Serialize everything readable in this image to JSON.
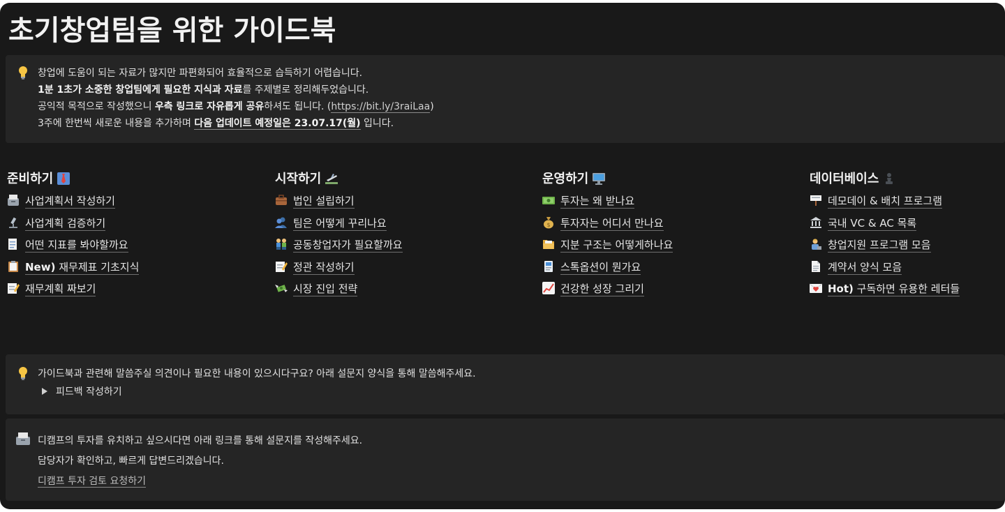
{
  "page_title": "초기창업팀을 위한 가이드북",
  "intro_callout": {
    "icon": "lightbulb-icon",
    "line1": "창업에 도움이 되는 자료가 많지만 파편화되어 효율적으로 습득하기 어렵습니다.",
    "line2_bold": "1분 1초가 소중한 창업팀에게 필요한 지식과 자료",
    "line2_rest": "를 주제별로 정리해두었습니다.",
    "line3_a": "공익적 목적으로 작성했으니 ",
    "line3_bold": "우측 링크로 자유롭게 공유",
    "line3_b": "하셔도 됩니다. (",
    "line3_link": "https://bit.ly/3raiLaa",
    "line3_c": ")",
    "line4_a": "3주에 한번씩 새로운 내용을 추가하며 ",
    "line4_bold": "다음 업데이트 예정일은 23.07.17(월)",
    "line4_b": " 입니다."
  },
  "columns": [
    {
      "heading": "준비하기",
      "heading_icon": "necktie-icon",
      "items": [
        {
          "icon": "card-file-box-icon",
          "prefix": "",
          "label": "사업계획서 작성하기"
        },
        {
          "icon": "microscope-icon",
          "prefix": "",
          "label": "사업계획 검증하기"
        },
        {
          "icon": "page-facing-up-icon",
          "prefix": "",
          "label": "어떤 지표를 봐야할까요"
        },
        {
          "icon": "clipboard-icon",
          "prefix": "New)",
          "label": " 재무제표 기초지식"
        },
        {
          "icon": "memo-icon",
          "prefix": "",
          "label": "재무계획 짜보기"
        }
      ]
    },
    {
      "heading": "시작하기",
      "heading_icon": "airplane-departure-icon",
      "items": [
        {
          "icon": "briefcase-icon",
          "prefix": "",
          "label": "법인 설립하기"
        },
        {
          "icon": "busts-icon",
          "prefix": "",
          "label": "팀은 어떻게 꾸리나요"
        },
        {
          "icon": "two-people-icon",
          "prefix": "",
          "label": "공동창업자가 필요할까요"
        },
        {
          "icon": "memo-icon",
          "prefix": "",
          "label": "정관 작성하기"
        },
        {
          "icon": "money-wings-icon",
          "prefix": "",
          "label": "시장 진입 전략"
        }
      ]
    },
    {
      "heading": "운영하기",
      "heading_icon": "desktop-computer-icon",
      "items": [
        {
          "icon": "dollar-banknote-icon",
          "prefix": "",
          "label": "투자는 왜 받나요"
        },
        {
          "icon": "money-bag-icon",
          "prefix": "",
          "label": "투자자는 어디서 만나요"
        },
        {
          "icon": "open-folder-icon",
          "prefix": "",
          "label": "지분 구조는 어떻게하나요"
        },
        {
          "icon": "id-card-icon",
          "prefix": "",
          "label": "스톡옵션이 뭔가요"
        },
        {
          "icon": "chart-increasing-icon",
          "prefix": "",
          "label": "건강한 성장 그리기"
        }
      ]
    },
    {
      "heading": "데이터베이스",
      "heading_icon": "chess-pawn-icon",
      "items": [
        {
          "icon": "signpost-icon",
          "prefix": "",
          "label": "데모데이 & 배치 프로그램"
        },
        {
          "icon": "bank-icon",
          "prefix": "",
          "label": "국내 VC & AC 목록"
        },
        {
          "icon": "person-office-worker-icon",
          "prefix": "",
          "label": "창업지원 프로그램 모음"
        },
        {
          "icon": "document-icon",
          "prefix": "",
          "label": "계약서 양식 모음"
        },
        {
          "icon": "love-letter-icon",
          "prefix": "Hot)",
          "label": " 구독하면 유용한 레터들"
        }
      ]
    }
  ],
  "feedback_callout": {
    "icon": "lightbulb-icon",
    "text": "가이드북과 관련해 말씀주실 의견이나 필요한 내용이 있으시다구요? 아래 설문지 양식을 통해 말씀해주세요.",
    "toggle_label": "피드백 작성하기"
  },
  "invest_callout": {
    "icon": "card-file-box-icon",
    "line1": "디캠프의 투자를 유치하고 싶으시다면 아래 링크를 통해 설문지를 작성해주세요.",
    "line2": "담당자가 확인하고, 빠르게 답변드리겠습니다.",
    "link": "디캠프 투자 검토 요청하기"
  }
}
